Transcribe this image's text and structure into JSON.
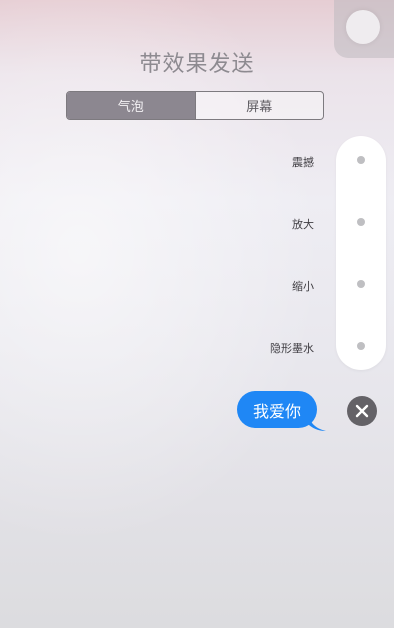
{
  "header": {
    "title": "带效果发送"
  },
  "tabs": [
    {
      "label": "气泡",
      "active": true
    },
    {
      "label": "屏幕",
      "active": false
    }
  ],
  "effects": [
    {
      "label": "震撼"
    },
    {
      "label": "放大"
    },
    {
      "label": "缩小"
    },
    {
      "label": "隐形墨水"
    }
  ],
  "message": {
    "text": "我爱你",
    "bubble_color": "#1f87f5"
  },
  "icons": {
    "close": "close-icon",
    "top_right": "effect-preview-icon"
  }
}
